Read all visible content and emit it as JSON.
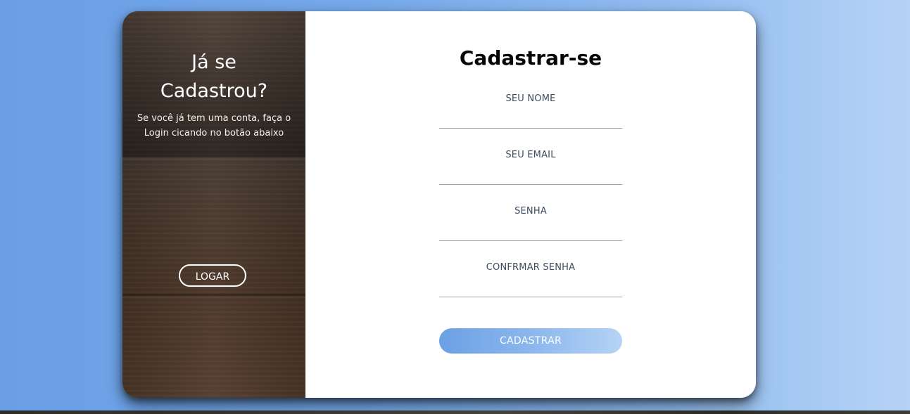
{
  "sidebar": {
    "title_line1": "Já se",
    "title_line2": "Cadastrou?",
    "description": "Se você já tem uma conta, faça o Login cicando no botão abaixo",
    "login_button": "LOGAR"
  },
  "form": {
    "title": "Cadastrar-se",
    "fields": [
      {
        "label": "SEU NOME",
        "value": "",
        "placeholder": ""
      },
      {
        "label": "SEU EMAIL",
        "value": "",
        "placeholder": ""
      },
      {
        "label": "SENHA",
        "value": "",
        "placeholder": ""
      },
      {
        "label": "CONFRMAR SENHA",
        "value": "",
        "placeholder": ""
      }
    ],
    "submit_button": "CADASTRAR"
  },
  "colors": {
    "background_start": "#6a9fe6",
    "background_end": "#b6d3f6",
    "button_gradient_start": "#6ba0e4",
    "button_gradient_end": "#b5d3f5",
    "panel_wood": "#4b3a2e"
  }
}
